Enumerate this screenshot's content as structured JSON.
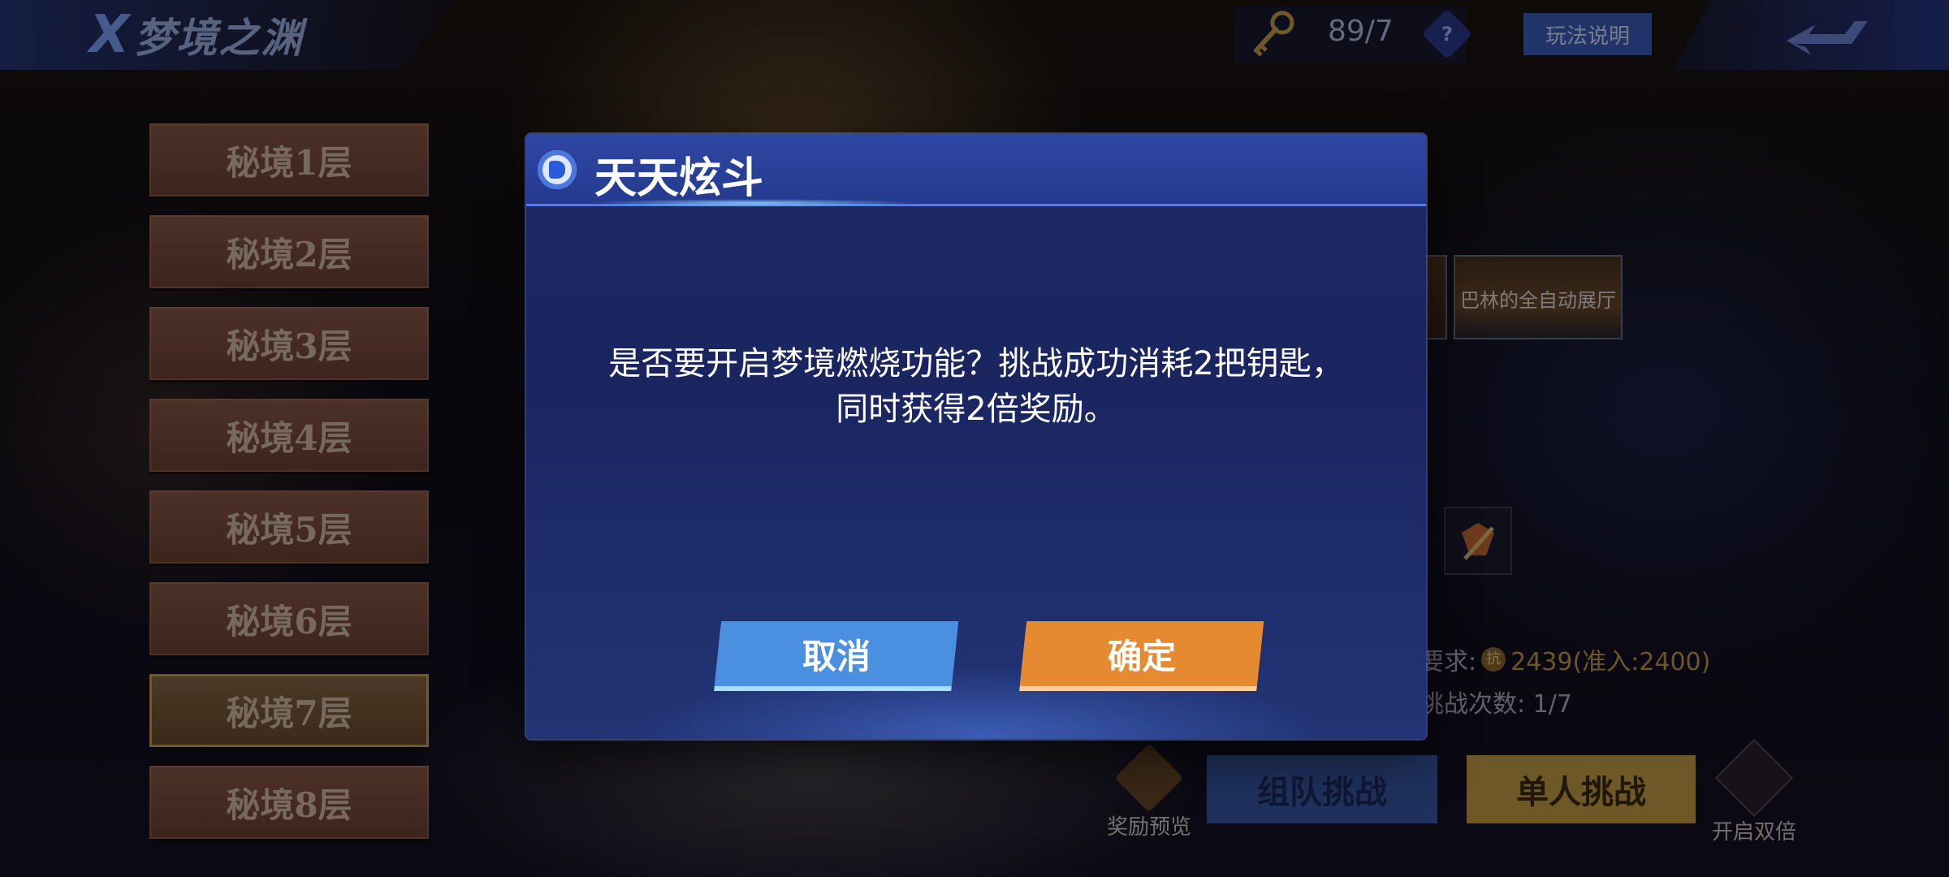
{
  "header": {
    "logo_text": "梦境之渊",
    "key_count": "89/7",
    "help_glyph": "?",
    "rules_label": "玩法说明"
  },
  "floors": [
    {
      "label": "秘境1层",
      "active": false
    },
    {
      "label": "秘境2层",
      "active": false
    },
    {
      "label": "秘境3层",
      "active": false
    },
    {
      "label": "秘境4层",
      "active": false
    },
    {
      "label": "秘境5层",
      "active": false
    },
    {
      "label": "秘境6层",
      "active": false
    },
    {
      "label": "秘境7层",
      "active": true
    },
    {
      "label": "秘境8层",
      "active": false
    }
  ],
  "background": {
    "thumbnail_label": "巴林的全自动展厅",
    "requirement_label": "要求:",
    "requirement_icon_glyph": "抗",
    "requirement_value": "2439(准入:2400)",
    "challenge_count": "挑战次数: 1/7",
    "reward_preview_label": "奖励预览",
    "team_challenge_label": "组队挑战",
    "solo_challenge_label": "单人挑战",
    "double_label": "开启双倍"
  },
  "dialog": {
    "title": "天天炫斗",
    "message_line1": "是否要开启梦境燃烧功能？挑战成功消耗2把钥匙，",
    "message_line2": "同时获得2倍奖励。",
    "cancel_label": "取消",
    "confirm_label": "确定"
  },
  "colors": {
    "cancel": "#4b8fe0",
    "confirm": "#e58a30",
    "dialog_header": "#2f47a6"
  }
}
